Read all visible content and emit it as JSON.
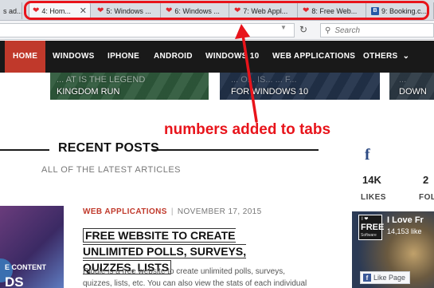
{
  "browser": {
    "tabs": [
      {
        "label": "s ad...",
        "icon": "none"
      },
      {
        "label": "4: Hom...",
        "icon": "heart-icon",
        "active": true
      },
      {
        "label": "5: Windows ...",
        "icon": "heart-icon"
      },
      {
        "label": "6: Windows ...",
        "icon": "heart-icon"
      },
      {
        "label": "7: Web Appl...",
        "icon": "heart-icon"
      },
      {
        "label": "8: Free Web...",
        "icon": "heart-icon"
      },
      {
        "label": "9: Booking.c...",
        "icon": "booking-icon"
      }
    ],
    "search_placeholder": "Search",
    "highlight_color": "#e8141b"
  },
  "site_nav": {
    "items": [
      "HOME",
      "WINDOWS",
      "IPHONE",
      "ANDROID",
      "WINDOWS 10",
      "WEB APPLICATIONS",
      "OTHERS"
    ],
    "active": "HOME",
    "active_color": "#c0392b",
    "bg_color": "#191919"
  },
  "featured": [
    {
      "line1": "... AT IS THE LEGEND",
      "line2": "KINGDOM RUN"
    },
    {
      "line1": "... O... IS... ... F...",
      "line2": "FOR WINDOWS 10"
    },
    {
      "line1": "...",
      "line2": "DOWN"
    }
  ],
  "annotation": {
    "text": "numbers added to tabs",
    "color": "#e8141b"
  },
  "recent_posts": {
    "title": "RECENT POSTS",
    "subtitle": "ALL OF THE LATEST ARTICLES"
  },
  "social": {
    "fb_glyph": "f",
    "likes": {
      "count": "14K",
      "label": "LIKES"
    },
    "follows": {
      "count": "2",
      "label": "FOLL"
    }
  },
  "post": {
    "category": "WEB APPLICATIONS",
    "separator": "|",
    "date": "NOVEMBER 17, 2015",
    "title": "FREE WEBSITE TO CREATE UNLIMITED POLLS, SURVEYS, QUIZZES, LISTS",
    "excerpt": "Riddle is a free website to create unlimited polls, surveys, quizzes, lists, etc. You can also view the stats of each individual task",
    "thumb_line1": "E CONTENT",
    "thumb_line2": "DS"
  },
  "fb_box": {
    "logo_top": "I ❤",
    "logo_mid": "FREE",
    "logo_bottom": "Software",
    "page_name": "I Love Fr",
    "likes": "14,153 like",
    "like_button": "Like Page"
  }
}
